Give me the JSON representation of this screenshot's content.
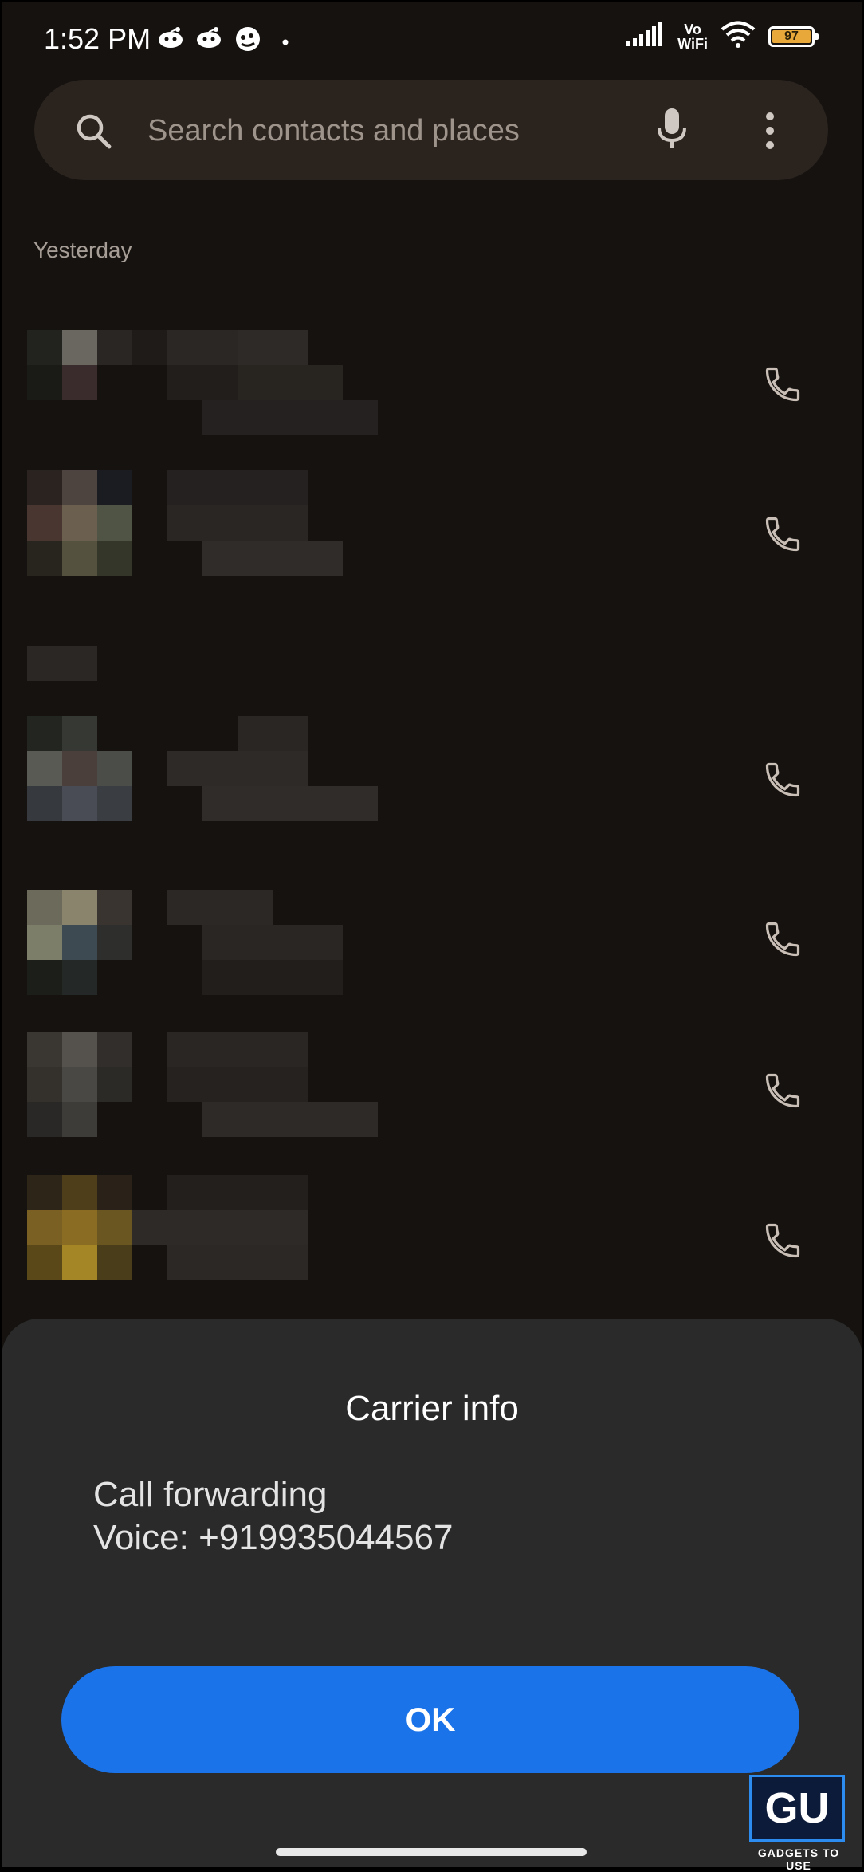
{
  "status_bar": {
    "time": "1:52 PM",
    "network_label_top": "Vo",
    "network_label_bottom": "WiFi",
    "battery_level": "97",
    "battery_color": "#e8a93a"
  },
  "search": {
    "placeholder": "Search contacts and places",
    "mic_icon": "mic-icon",
    "more_icon": "more-vertical-icon"
  },
  "call_log": {
    "section_header": "Yesterday",
    "entries": [
      {
        "icon": "phone-icon",
        "name_obscured": true
      },
      {
        "icon": "phone-icon",
        "name_obscured": true
      },
      {
        "icon": "phone-icon",
        "name_obscured": true
      },
      {
        "icon": "phone-icon",
        "name_obscured": true
      },
      {
        "icon": "phone-icon",
        "name_obscured": true
      },
      {
        "icon": "phone-icon",
        "name_obscured": true
      }
    ]
  },
  "dialog": {
    "title": "Carrier info",
    "line1": "Call forwarding",
    "line2": "Voice: +919935044567",
    "ok_label": "OK",
    "ok_color": "#1a73e8"
  },
  "watermark": {
    "logo": "GU",
    "text": "GADGETS TO USE"
  }
}
